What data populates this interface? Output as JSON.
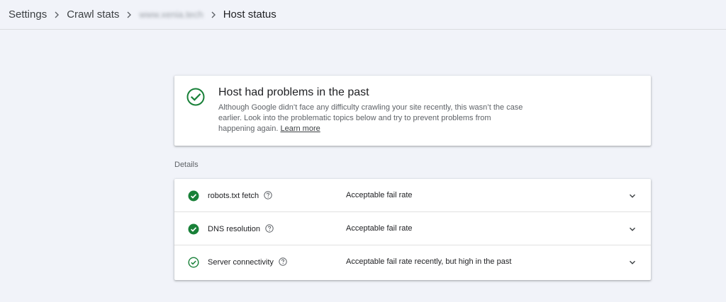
{
  "breadcrumb": {
    "items": [
      {
        "label": "Settings"
      },
      {
        "label": "Crawl stats"
      },
      {
        "label": "www.xenia.tech"
      },
      {
        "label": "Host status"
      }
    ]
  },
  "summary": {
    "title": "Host had problems in the past",
    "description": "Although Google didn’t face any difficulty crawling your site recently, this wasn’t the case earlier. Look into the problematic topics below and try to prevent problems from happening again.",
    "link": "Learn more"
  },
  "details": {
    "label": "Details",
    "rows": [
      {
        "name": "robots.txt fetch",
        "status": "Acceptable fail rate",
        "icon": "check-circle-filled-icon"
      },
      {
        "name": "DNS resolution",
        "status": "Acceptable fail rate",
        "icon": "check-circle-filled-icon"
      },
      {
        "name": "Server connectivity",
        "status": "Acceptable fail rate recently, but high in the past",
        "icon": "check-circle-outline-icon"
      }
    ]
  },
  "colors": {
    "success": "#188038",
    "background": "#f1f3f9"
  }
}
